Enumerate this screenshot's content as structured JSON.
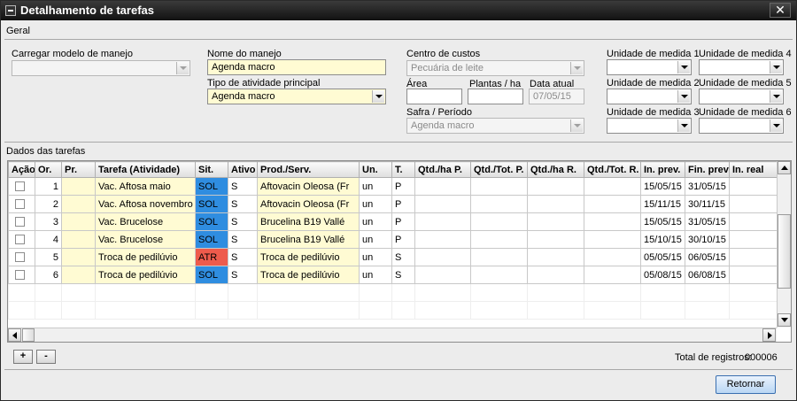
{
  "window": {
    "title": "Detalhamento de tarefas",
    "close_label": "✕"
  },
  "geral": {
    "section_title": "Geral",
    "carregar_modelo": {
      "label": "Carregar modelo de manejo",
      "value": ""
    },
    "nome_manejo": {
      "label": "Nome do manejo",
      "value": "Agenda macro"
    },
    "tipo_atividade": {
      "label": "Tipo de atividade principal",
      "value": "Agenda macro"
    },
    "centro_custos": {
      "label": "Centro de custos",
      "value": "Pecuária de leite"
    },
    "area": {
      "label": "Área",
      "value": ""
    },
    "plantas_ha": {
      "label": "Plantas / ha",
      "value": ""
    },
    "data_atual": {
      "label": "Data atual",
      "value": "07/05/15"
    },
    "safra_periodo": {
      "label": "Safra / Período",
      "value": "Agenda macro"
    },
    "unidades": [
      {
        "label": "Unidade de medida 1",
        "value": ""
      },
      {
        "label": "Unidade de medida 4",
        "value": ""
      },
      {
        "label": "Unidade de medida 2",
        "value": ""
      },
      {
        "label": "Unidade de medida 5",
        "value": ""
      },
      {
        "label": "Unidade de medida 3",
        "value": ""
      },
      {
        "label": "Unidade de medida 6",
        "value": ""
      }
    ]
  },
  "tarefas": {
    "section_title": "Dados das tarefas",
    "columns": [
      "Ação",
      "Or.",
      "Pr.",
      "Tarefa (Atividade)",
      "Sit.",
      "Ativo",
      "Prod./Serv.",
      "Un.",
      "T.",
      "Qtd./ha P.",
      "Qtd./Tot. P.",
      "Qtd./ha  R.",
      "Qtd./Tot. R.",
      "In. prev.",
      "Fin. prev",
      "In. real"
    ],
    "rows": [
      {
        "or": "1",
        "pr": "",
        "tarefa": "Vac. Aftosa maio",
        "sit": "SOL",
        "ativo": "S",
        "prod": "Aftovacin Oleosa (Fr",
        "un": "un",
        "t": "P",
        "qha_p": "",
        "qtot_p": "",
        "qha_r": "",
        "qtot_r": "",
        "in_prev": "15/05/15",
        "fin_prev": "31/05/15",
        "in_real": ""
      },
      {
        "or": "2",
        "pr": "",
        "tarefa": "Vac. Aftosa novembro",
        "sit": "SOL",
        "ativo": "S",
        "prod": "Aftovacin Oleosa (Fr",
        "un": "un",
        "t": "P",
        "qha_p": "",
        "qtot_p": "",
        "qha_r": "",
        "qtot_r": "",
        "in_prev": "15/11/15",
        "fin_prev": "30/11/15",
        "in_real": ""
      },
      {
        "or": "3",
        "pr": "",
        "tarefa": "Vac. Brucelose",
        "sit": "SOL",
        "ativo": "S",
        "prod": "Brucelina B19 Vallé",
        "un": "un",
        "t": "P",
        "qha_p": "",
        "qtot_p": "",
        "qha_r": "",
        "qtot_r": "",
        "in_prev": "15/05/15",
        "fin_prev": "31/05/15",
        "in_real": ""
      },
      {
        "or": "4",
        "pr": "",
        "tarefa": "Vac. Brucelose",
        "sit": "SOL",
        "ativo": "S",
        "prod": "Brucelina B19 Vallé",
        "un": "un",
        "t": "P",
        "qha_p": "",
        "qtot_p": "",
        "qha_r": "",
        "qtot_r": "",
        "in_prev": "15/10/15",
        "fin_prev": "30/10/15",
        "in_real": ""
      },
      {
        "or": "5",
        "pr": "",
        "tarefa": "Troca de pedilúvio",
        "sit": "ATR",
        "ativo": "S",
        "prod": "Troca de pedilúvio",
        "un": "un",
        "t": "S",
        "qha_p": "",
        "qtot_p": "",
        "qha_r": "",
        "qtot_r": "",
        "in_prev": "05/05/15",
        "fin_prev": "06/05/15",
        "in_real": ""
      },
      {
        "or": "6",
        "pr": "",
        "tarefa": "Troca de pedilúvio",
        "sit": "SOL",
        "ativo": "S",
        "prod": "Troca de pedilúvio",
        "un": "un",
        "t": "S",
        "qha_p": "",
        "qtot_p": "",
        "qha_r": "",
        "qtot_r": "",
        "in_prev": "05/08/15",
        "fin_prev": "06/08/15",
        "in_real": ""
      }
    ],
    "status_colors": {
      "SOL": "#2f8de0",
      "ATR": "#ee5b4c"
    }
  },
  "footer": {
    "add_label": "+",
    "remove_label": "-",
    "total_label": "Total de registros:",
    "total_value": "000006",
    "retornar_label": "Retornar"
  }
}
